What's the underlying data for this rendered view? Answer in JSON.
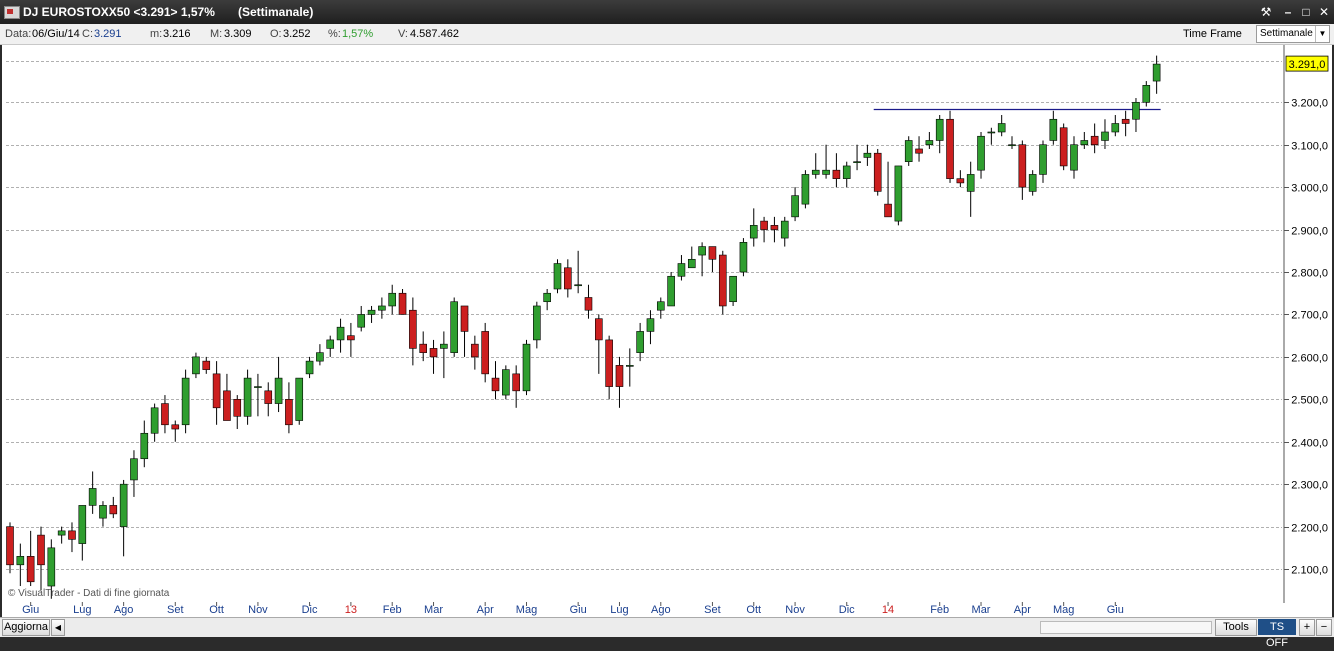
{
  "window": {
    "title": "DJ EUROSTOXX50 <3.291> 1,57%",
    "period": "(Settimanale)",
    "buttons": {
      "tools": "⚒",
      "minimize": "–",
      "maximize": "□",
      "close": "✕"
    }
  },
  "infobar": {
    "date_label": "Data:",
    "date_value": "06/Giu/14",
    "close_label": "C:",
    "close_value": "3.291",
    "min_label": "m:",
    "min_value": "3.216",
    "max_label": "M:",
    "max_value": "3.309",
    "open_label": "O:",
    "open_value": "3.252",
    "pct_label": "%:",
    "pct_value": "1,57%",
    "vol_label": "V:",
    "vol_value": "4.587.462",
    "time_frame_label": "Time Frame",
    "time_frame_value": "Settimanale",
    "dropdown_icon": "chevron-down-icon"
  },
  "chart": {
    "watermark": "© VisualTrader - Dati di fine giornata",
    "last_price_label": "3.291,0",
    "colors": {
      "up": "#2f9e2f",
      "down": "#cc1f1f",
      "grid": "#b0b0b0",
      "resistance": "#1a1a8c",
      "price_tag": "#ffff00"
    }
  },
  "chart_data": {
    "type": "candlestick",
    "ylim": [
      2020,
      3335
    ],
    "y_ticks": [
      "2.100,0",
      "2.200,0",
      "2.300,0",
      "2.400,0",
      "2.500,0",
      "2.600,0",
      "2.700,0",
      "2.800,0",
      "2.900,0",
      "3.000,0",
      "3.100,0",
      "3.200,0"
    ],
    "y_tick_values": [
      2100,
      2200,
      2300,
      2400,
      2500,
      2600,
      2700,
      2800,
      2900,
      3000,
      3100,
      3200
    ],
    "x_labels": [
      {
        "label": "Giu",
        "index": 2,
        "color": "#1a3f8f"
      },
      {
        "label": "Lug",
        "index": 7,
        "color": "#1a3f8f"
      },
      {
        "label": "Ago",
        "index": 11,
        "color": "#1a3f8f"
      },
      {
        "label": "Set",
        "index": 16,
        "color": "#1a3f8f"
      },
      {
        "label": "Ott",
        "index": 20,
        "color": "#1a3f8f"
      },
      {
        "label": "Nov",
        "index": 24,
        "color": "#1a3f8f"
      },
      {
        "label": "Dic",
        "index": 29,
        "color": "#1a3f8f"
      },
      {
        "label": "13",
        "index": 33,
        "color": "#cc1f1f"
      },
      {
        "label": "Feb",
        "index": 37,
        "color": "#1a3f8f"
      },
      {
        "label": "Mar",
        "index": 41,
        "color": "#1a3f8f"
      },
      {
        "label": "Apr",
        "index": 46,
        "color": "#1a3f8f"
      },
      {
        "label": "Mag",
        "index": 50,
        "color": "#1a3f8f"
      },
      {
        "label": "Giu",
        "index": 55,
        "color": "#1a3f8f"
      },
      {
        "label": "Lug",
        "index": 59,
        "color": "#1a3f8f"
      },
      {
        "label": "Ago",
        "index": 63,
        "color": "#1a3f8f"
      },
      {
        "label": "Set",
        "index": 68,
        "color": "#1a3f8f"
      },
      {
        "label": "Ott",
        "index": 72,
        "color": "#1a3f8f"
      },
      {
        "label": "Nov",
        "index": 76,
        "color": "#1a3f8f"
      },
      {
        "label": "Dic",
        "index": 81,
        "color": "#1a3f8f"
      },
      {
        "label": "14",
        "index": 85,
        "color": "#cc1f1f"
      },
      {
        "label": "Feb",
        "index": 90,
        "color": "#1a3f8f"
      },
      {
        "label": "Mar",
        "index": 94,
        "color": "#1a3f8f"
      },
      {
        "label": "Apr",
        "index": 98,
        "color": "#1a3f8f"
      },
      {
        "label": "Mag",
        "index": 102,
        "color": "#1a3f8f"
      },
      {
        "label": "Giu",
        "index": 107,
        "color": "#1a3f8f"
      }
    ],
    "candles": [
      [
        2200,
        2210,
        2090,
        2110
      ],
      [
        2110,
        2160,
        2060,
        2130
      ],
      [
        2130,
        2190,
        2060,
        2070
      ],
      [
        2180,
        2200,
        2050,
        2110
      ],
      [
        2060,
        2170,
        2030,
        2150
      ],
      [
        2180,
        2200,
        2160,
        2190
      ],
      [
        2190,
        2210,
        2140,
        2170
      ],
      [
        2160,
        2250,
        2120,
        2250
      ],
      [
        2250,
        2330,
        2230,
        2290
      ],
      [
        2220,
        2260,
        2200,
        2250
      ],
      [
        2250,
        2270,
        2220,
        2230
      ],
      [
        2200,
        2310,
        2130,
        2300
      ],
      [
        2310,
        2380,
        2270,
        2360
      ],
      [
        2360,
        2450,
        2340,
        2420
      ],
      [
        2420,
        2490,
        2400,
        2480
      ],
      [
        2490,
        2510,
        2420,
        2440
      ],
      [
        2440,
        2450,
        2400,
        2430
      ],
      [
        2440,
        2570,
        2420,
        2550
      ],
      [
        2560,
        2610,
        2550,
        2600
      ],
      [
        2590,
        2600,
        2560,
        2570
      ],
      [
        2560,
        2590,
        2440,
        2480
      ],
      [
        2520,
        2560,
        2450,
        2450
      ],
      [
        2500,
        2510,
        2430,
        2460
      ],
      [
        2460,
        2570,
        2440,
        2550
      ],
      [
        2530,
        2560,
        2460,
        2530
      ],
      [
        2520,
        2540,
        2460,
        2490
      ],
      [
        2490,
        2600,
        2470,
        2550
      ],
      [
        2500,
        2540,
        2420,
        2440
      ],
      [
        2450,
        2550,
        2440,
        2550
      ],
      [
        2560,
        2600,
        2550,
        2590
      ],
      [
        2590,
        2630,
        2580,
        2610
      ],
      [
        2620,
        2650,
        2600,
        2640
      ],
      [
        2640,
        2690,
        2610,
        2670
      ],
      [
        2650,
        2680,
        2600,
        2640
      ],
      [
        2670,
        2720,
        2660,
        2700
      ],
      [
        2700,
        2720,
        2680,
        2710
      ],
      [
        2710,
        2740,
        2690,
        2720
      ],
      [
        2720,
        2770,
        2700,
        2750
      ],
      [
        2750,
        2760,
        2700,
        2700
      ],
      [
        2710,
        2740,
        2580,
        2620
      ],
      [
        2630,
        2660,
        2590,
        2610
      ],
      [
        2620,
        2640,
        2560,
        2600
      ],
      [
        2620,
        2660,
        2550,
        2630
      ],
      [
        2610,
        2740,
        2600,
        2730
      ],
      [
        2720,
        2720,
        2600,
        2660
      ],
      [
        2630,
        2650,
        2570,
        2600
      ],
      [
        2660,
        2680,
        2540,
        2560
      ],
      [
        2550,
        2590,
        2500,
        2520
      ],
      [
        2510,
        2580,
        2500,
        2570
      ],
      [
        2560,
        2580,
        2480,
        2520
      ],
      [
        2520,
        2640,
        2510,
        2630
      ],
      [
        2640,
        2730,
        2620,
        2720
      ],
      [
        2730,
        2760,
        2710,
        2750
      ],
      [
        2760,
        2830,
        2750,
        2820
      ],
      [
        2810,
        2830,
        2740,
        2760
      ],
      [
        2770,
        2850,
        2750,
        2770
      ],
      [
        2740,
        2770,
        2690,
        2710
      ],
      [
        2690,
        2700,
        2560,
        2640
      ],
      [
        2640,
        2650,
        2500,
        2530
      ],
      [
        2580,
        2600,
        2480,
        2530
      ],
      [
        2580,
        2620,
        2530,
        2580
      ],
      [
        2610,
        2680,
        2590,
        2660
      ],
      [
        2660,
        2710,
        2630,
        2690
      ],
      [
        2710,
        2740,
        2690,
        2730
      ],
      [
        2720,
        2800,
        2720,
        2790
      ],
      [
        2790,
        2840,
        2780,
        2820
      ],
      [
        2810,
        2860,
        2810,
        2830
      ],
      [
        2840,
        2870,
        2790,
        2860
      ],
      [
        2860,
        2860,
        2800,
        2830
      ],
      [
        2840,
        2850,
        2700,
        2720
      ],
      [
        2730,
        2790,
        2720,
        2790
      ],
      [
        2800,
        2880,
        2790,
        2870
      ],
      [
        2880,
        2950,
        2860,
        2910
      ],
      [
        2920,
        2930,
        2870,
        2900
      ],
      [
        2910,
        2930,
        2870,
        2900
      ],
      [
        2880,
        2930,
        2860,
        2920
      ],
      [
        2930,
        3000,
        2920,
        2980
      ],
      [
        2960,
        3040,
        2950,
        3030
      ],
      [
        3030,
        3080,
        3020,
        3040
      ],
      [
        3030,
        3100,
        3020,
        3040
      ],
      [
        3040,
        3080,
        3000,
        3020
      ],
      [
        3020,
        3060,
        3000,
        3050
      ],
      [
        3060,
        3100,
        3040,
        3060
      ],
      [
        3070,
        3100,
        3050,
        3080
      ],
      [
        3080,
        3090,
        2980,
        2990
      ],
      [
        2960,
        3060,
        2930,
        2930
      ],
      [
        2920,
        3050,
        2910,
        3050
      ],
      [
        3060,
        3120,
        3050,
        3110
      ],
      [
        3090,
        3120,
        3060,
        3080
      ],
      [
        3100,
        3130,
        3090,
        3110
      ],
      [
        3110,
        3170,
        3080,
        3160
      ],
      [
        3160,
        3180,
        3010,
        3020
      ],
      [
        3020,
        3040,
        3000,
        3010
      ],
      [
        2990,
        3060,
        2930,
        3030
      ],
      [
        3040,
        3130,
        3020,
        3120
      ],
      [
        3130,
        3140,
        3100,
        3130
      ],
      [
        3130,
        3170,
        3120,
        3150
      ],
      [
        3100,
        3120,
        3090,
        3100
      ],
      [
        3100,
        3110,
        2970,
        3000
      ],
      [
        2990,
        3040,
        2980,
        3030
      ],
      [
        3030,
        3110,
        3010,
        3100
      ],
      [
        3110,
        3180,
        3100,
        3160
      ],
      [
        3140,
        3150,
        3040,
        3050
      ],
      [
        3040,
        3120,
        3020,
        3100
      ],
      [
        3100,
        3130,
        3090,
        3110
      ],
      [
        3120,
        3150,
        3080,
        3100
      ],
      [
        3110,
        3160,
        3090,
        3130
      ],
      [
        3130,
        3170,
        3120,
        3150
      ],
      [
        3160,
        3180,
        3120,
        3150
      ],
      [
        3160,
        3210,
        3130,
        3200
      ],
      [
        3200,
        3250,
        3190,
        3240
      ],
      [
        3250,
        3310,
        3220,
        3290
      ]
    ],
    "resistance": {
      "y": 3183,
      "from_index": 84,
      "to_index": 111
    }
  },
  "bottombar": {
    "refresh_label": "Aggiorna",
    "tools_label": "Tools",
    "ts_label": "TS OFF",
    "zoom_in": "+",
    "zoom_out": "−"
  }
}
